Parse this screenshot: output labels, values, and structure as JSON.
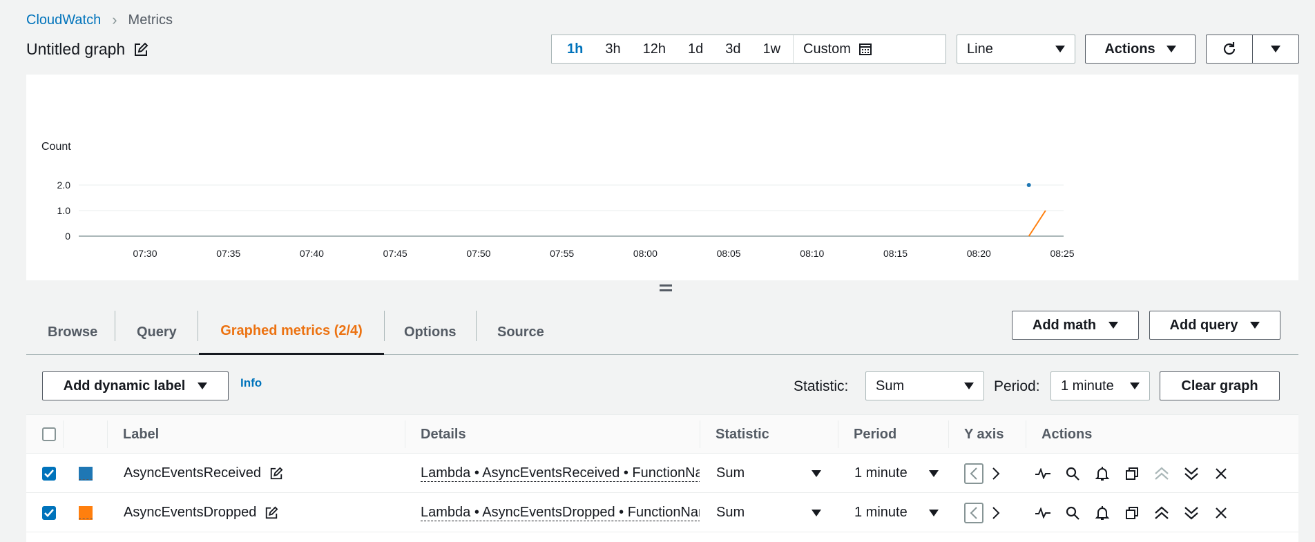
{
  "breadcrumb": {
    "root": "CloudWatch",
    "current": "Metrics"
  },
  "graph_title": "Untitled graph",
  "time_range": {
    "options": [
      "1h",
      "3h",
      "12h",
      "1d",
      "3d",
      "1w"
    ],
    "active": "1h",
    "custom_label": "Custom"
  },
  "chart_type": {
    "value": "Line"
  },
  "toolbar": {
    "actions_label": "Actions"
  },
  "chart_data": {
    "type": "line",
    "ylabel": "Count",
    "ylim": [
      0,
      2.0
    ],
    "yticks": [
      "2.0",
      "1.0",
      "0"
    ],
    "xticks": [
      "07:30",
      "07:35",
      "07:40",
      "07:45",
      "07:50",
      "07:55",
      "08:00",
      "08:05",
      "08:10",
      "08:15",
      "08:20",
      "08:25"
    ],
    "series": [
      {
        "name": "AsyncEventsReceived",
        "color": "#1f77b4",
        "x": [
          "08:23"
        ],
        "values": [
          2
        ]
      },
      {
        "name": "AsyncEventsDropped",
        "color": "#ff7f0e",
        "x": [
          "08:23",
          "08:24"
        ],
        "values": [
          0,
          1
        ]
      }
    ]
  },
  "tabs": [
    {
      "label": "Browse"
    },
    {
      "label": "Query"
    },
    {
      "label": "Graphed metrics (2/4)"
    },
    {
      "label": "Options"
    },
    {
      "label": "Source"
    }
  ],
  "tab_actions": {
    "add_math": "Add math",
    "add_query": "Add query"
  },
  "graphed": {
    "add_dynamic_label": "Add dynamic label",
    "info": "Info",
    "statistic_label": "Statistic:",
    "statistic_value": "Sum",
    "period_label": "Period:",
    "period_value": "1 minute",
    "clear_graph": "Clear graph"
  },
  "table": {
    "headers": {
      "label": "Label",
      "details": "Details",
      "statistic": "Statistic",
      "period": "Period",
      "yaxis": "Y axis",
      "actions": "Actions"
    },
    "rows": [
      {
        "checked": true,
        "color": "#1f77b4",
        "label": "AsyncEventsReceived",
        "details": "Lambda • AsyncEventsReceived • FunctionName",
        "statistic": "Sum",
        "period": "1 minute"
      },
      {
        "checked": true,
        "color": "#ff7f0e",
        "label": "AsyncEventsDropped",
        "details": "Lambda • AsyncEventsDropped • FunctionName",
        "statistic": "Sum",
        "period": "1 minute"
      }
    ]
  }
}
